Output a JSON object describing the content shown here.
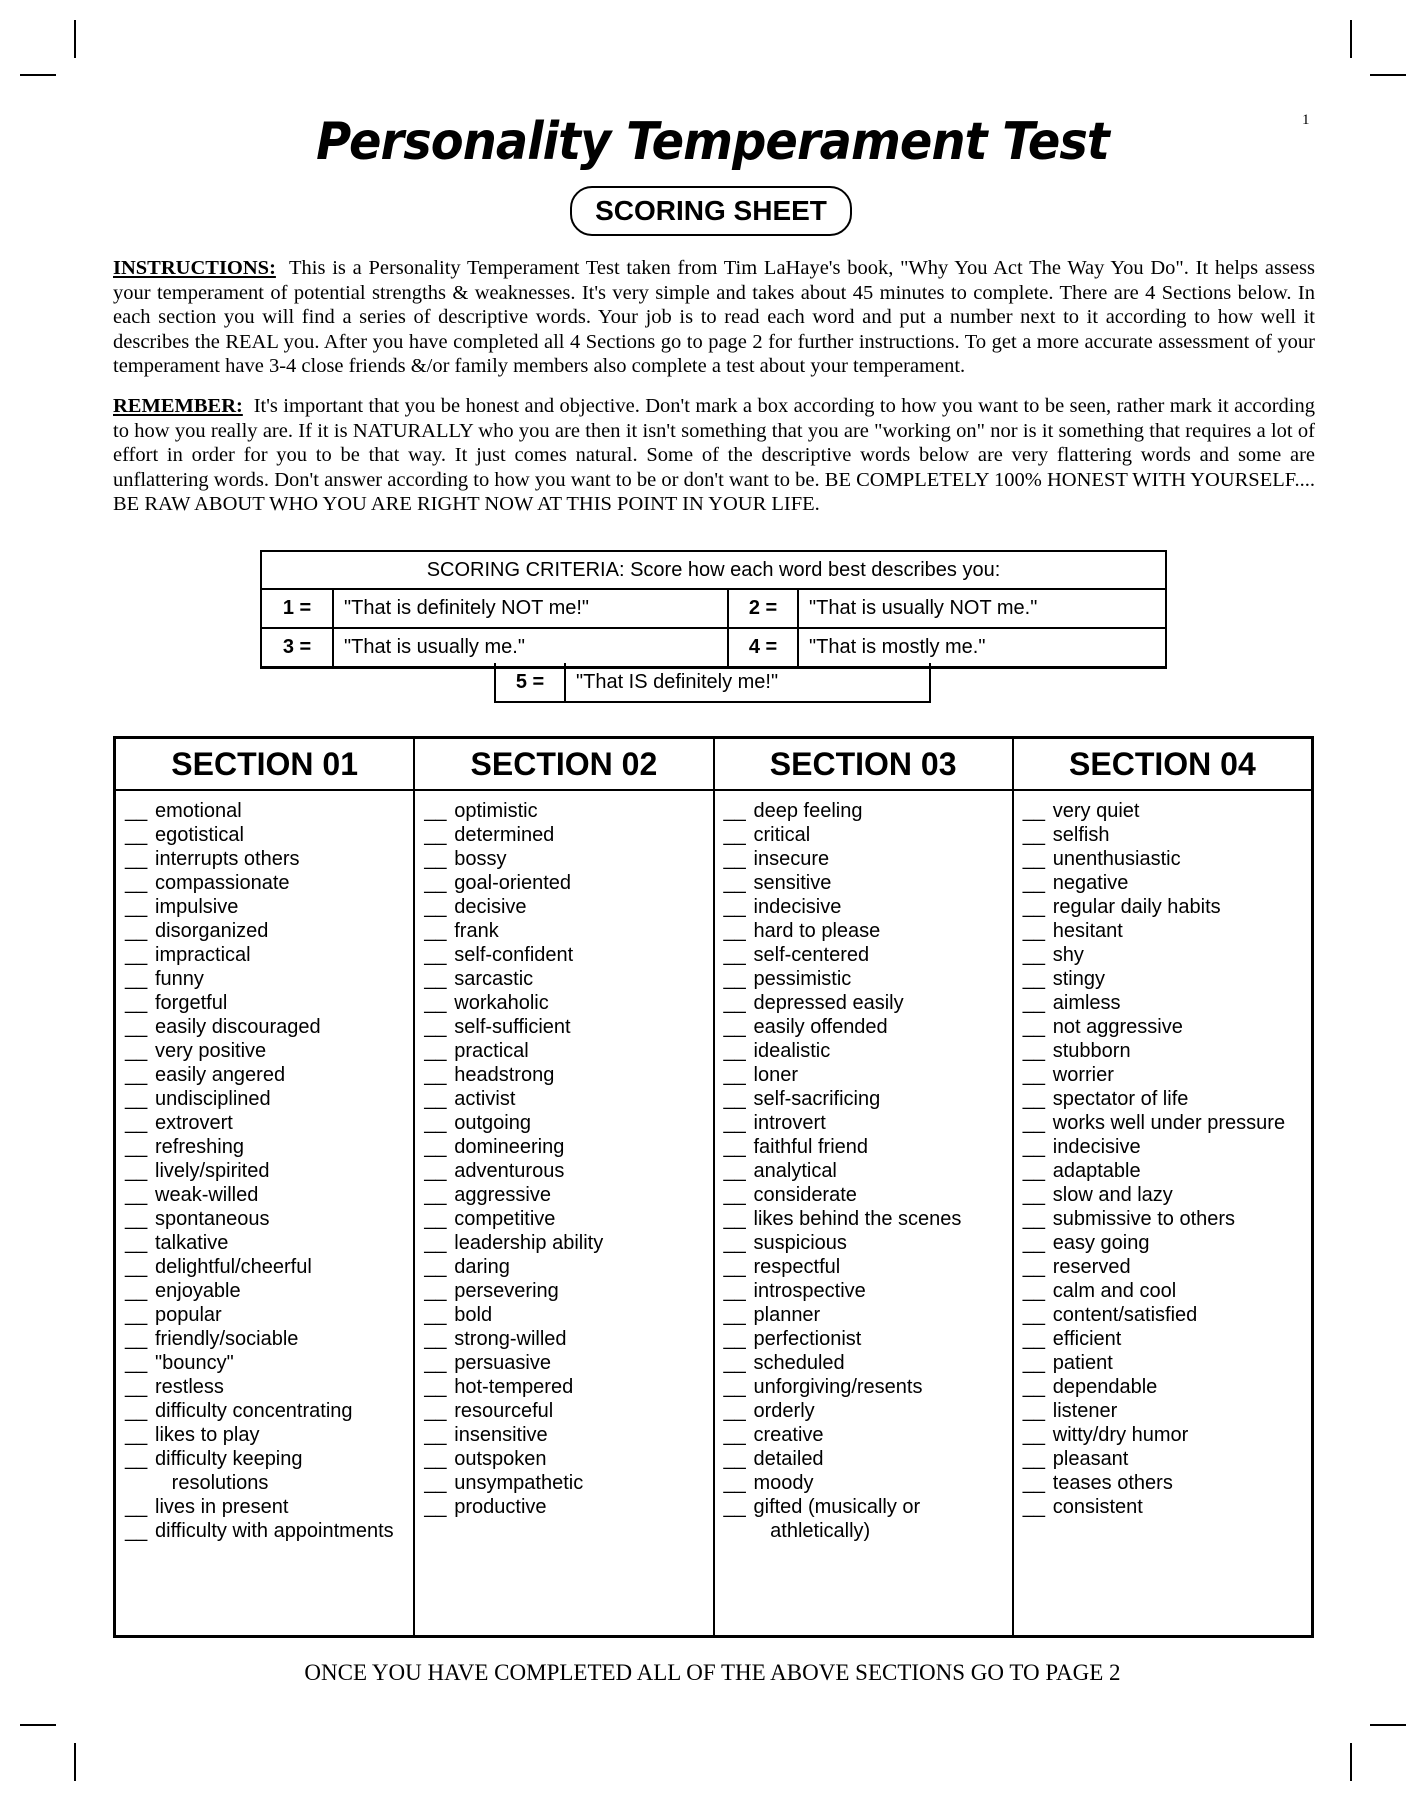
{
  "page_number": "1",
  "title": "Personality Temperament Test",
  "subtitle": "SCORING SHEET",
  "instructions": {
    "label": "INSTRUCTIONS:",
    "text": "This is a Personality Temperament Test taken from Tim LaHaye's book, \"Why You Act The Way You Do\". It helps assess your temperament of potential strengths & weaknesses. It's very simple and takes about 45 minutes to complete. There are 4 Sections below. In each section you will find a series of descriptive words. Your job is to read each word and put a number next to it according to how well it describes the REAL you. After you have completed all 4 Sections go to page 2 for further instructions. To get a more accurate assessment of your temperament have 3-4 close friends &/or family members also complete a test about your temperament."
  },
  "remember": {
    "label": "REMEMBER:",
    "text": "It's important that you be honest and objective. Don't mark a box according to how you want to be seen, rather mark it according to how you really are. If it is NATURALLY who you are then it isn't something that you are \"working on\" nor is it something that requires a lot of effort in order for you to be that way. It just comes natural. Some of the descriptive words below are very flattering words and some are unflattering words. Don't answer according to how you want to be or don't want to be. BE COMPLETELY 100% HONEST WITH YOURSELF.... BE RAW ABOUT WHO YOU ARE RIGHT NOW AT THIS POINT IN YOUR LIFE."
  },
  "criteria": {
    "heading": "SCORING CRITERIA: Score how each word best describes you:",
    "items": [
      {
        "num": "1 =",
        "text": "\"That is definitely NOT me!\""
      },
      {
        "num": "2 =",
        "text": "\"That is usually NOT me.\""
      },
      {
        "num": "3 =",
        "text": "\"That is usually me.\""
      },
      {
        "num": "4 =",
        "text": "\"That is mostly me.\""
      },
      {
        "num": "5 =",
        "text": "\"That IS definitely me!\""
      }
    ]
  },
  "blank": "__",
  "sections": [
    {
      "title": "SECTION 01",
      "words": [
        "emotional",
        "egotistical",
        "interrupts others",
        "compassionate",
        "impulsive",
        "disorganized",
        "impractical",
        "funny",
        "forgetful",
        "easily discouraged",
        "very positive",
        "easily angered",
        "undisciplined",
        "extrovert",
        "refreshing",
        "lively/spirited",
        "weak-willed",
        "spontaneous",
        "talkative",
        "delightful/cheerful",
        "enjoyable",
        "popular",
        "friendly/sociable",
        "\"bouncy\"",
        "restless",
        "difficulty concentrating",
        "likes to play",
        "difficulty keeping resolutions",
        "lives in present",
        "difficulty with appointments"
      ]
    },
    {
      "title": "SECTION 02",
      "words": [
        "optimistic",
        "determined",
        "bossy",
        "goal-oriented",
        "decisive",
        "frank",
        "self-confident",
        "sarcastic",
        "workaholic",
        "self-sufficient",
        "practical",
        "headstrong",
        "activist",
        "outgoing",
        "domineering",
        "adventurous",
        "aggressive",
        "competitive",
        "leadership ability",
        "daring",
        "persevering",
        "bold",
        "strong-willed",
        "persuasive",
        "hot-tempered",
        "resourceful",
        "insensitive",
        "outspoken",
        "unsympathetic",
        "productive"
      ]
    },
    {
      "title": "SECTION 03",
      "words": [
        "deep feeling",
        "critical",
        "insecure",
        "sensitive",
        "indecisive",
        "hard to please",
        "self-centered",
        "pessimistic",
        "depressed easily",
        "easily offended",
        "idealistic",
        "loner",
        "self-sacrificing",
        "introvert",
        "faithful friend",
        "analytical",
        "considerate",
        "likes behind the scenes",
        "suspicious",
        "respectful",
        "introspective",
        "planner",
        "perfectionist",
        "scheduled",
        "unforgiving/resents",
        "orderly",
        "creative",
        "detailed",
        "moody",
        "gifted (musically or athletically)"
      ]
    },
    {
      "title": "SECTION 04",
      "words": [
        "very quiet",
        "selfish",
        "unenthusiastic",
        "negative",
        "regular daily habits",
        "hesitant",
        "shy",
        "stingy",
        "aimless",
        "not aggressive",
        "stubborn",
        "worrier",
        "spectator of life",
        "works well under pressure",
        "indecisive",
        "adaptable",
        "slow and lazy",
        "submissive to others",
        "easy going",
        "reserved",
        "calm and cool",
        "content/satisfied",
        "efficient",
        "patient",
        "dependable",
        "listener",
        "witty/dry humor",
        "pleasant",
        "teases others",
        "consistent"
      ]
    }
  ],
  "wrapped": {
    "difficulty keeping resolutions": [
      "difficulty keeping",
      "resolutions"
    ],
    "gifted (musically or athletically)": [
      "gifted (musically or",
      "athletically)"
    ]
  },
  "footer": "ONCE YOU HAVE COMPLETED ALL OF THE ABOVE SECTIONS GO TO PAGE 2"
}
